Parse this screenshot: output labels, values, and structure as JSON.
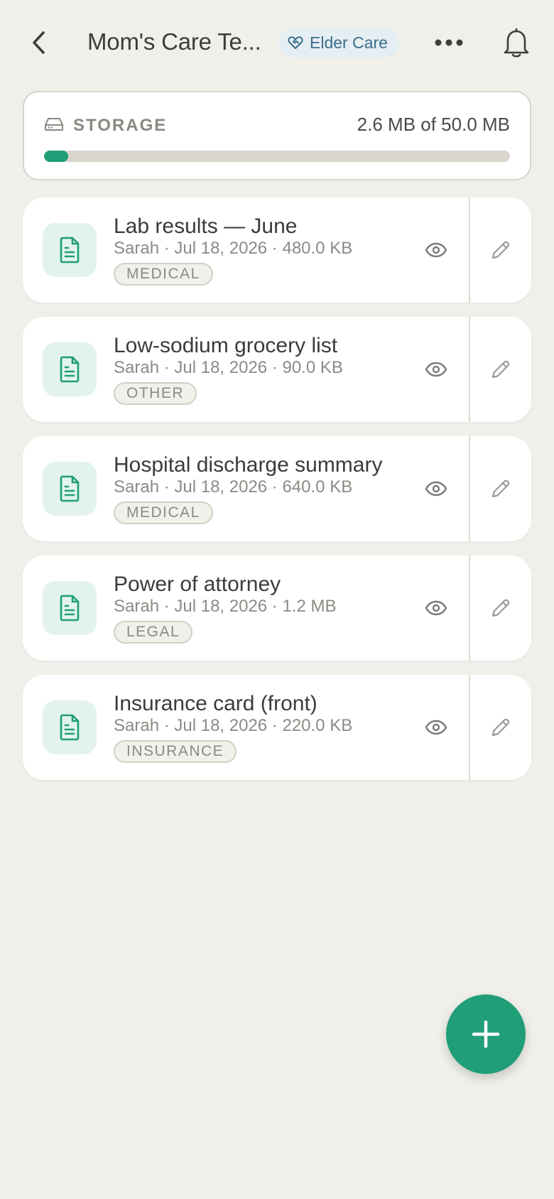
{
  "header": {
    "title": "Mom's Care Te...",
    "badge_label": "Elder Care",
    "icons": [
      "chevron-left-icon",
      "heart-handshake-icon",
      "more-horizontal-icon",
      "bell-icon"
    ]
  },
  "storage": {
    "label": "STORAGE",
    "value_text": "2.6 MB of 50.0 MB",
    "used_fraction": 0.052,
    "icon": "hard-drive-icon"
  },
  "documents": [
    {
      "name": "Lab results — June",
      "meta": "Sarah · Jul 18, 2026 · 480.0 KB",
      "tag": "MEDICAL"
    },
    {
      "name": "Low-sodium grocery list",
      "meta": "Sarah · Jul 18, 2026 · 90.0 KB",
      "tag": "OTHER"
    },
    {
      "name": "Hospital discharge summary",
      "meta": "Sarah · Jul 18, 2026 · 640.0 KB",
      "tag": "MEDICAL"
    },
    {
      "name": "Power of attorney",
      "meta": "Sarah · Jul 18, 2026 · 1.2 MB",
      "tag": "LEGAL"
    },
    {
      "name": "Insurance card (front)",
      "meta": "Sarah · Jul 18, 2026 · 220.0 KB",
      "tag": "INSURANCE"
    }
  ],
  "colors": {
    "accent": "#1f9e78",
    "background": "#f1efe9",
    "badge_bg": "#e5eef2",
    "badge_text": "#3a6e8c"
  }
}
